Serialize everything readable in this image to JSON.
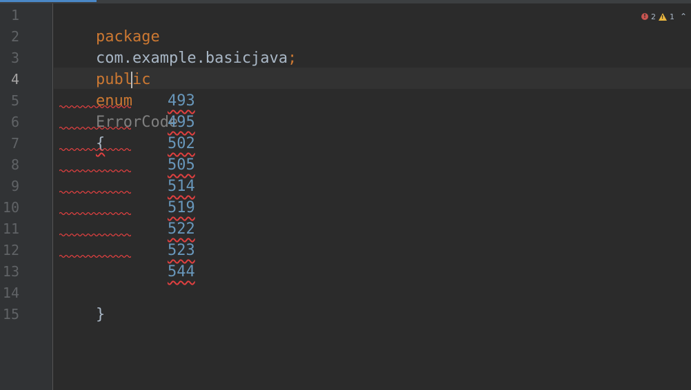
{
  "editor": {
    "line_numbers": [
      "1",
      "2",
      "3",
      "4",
      "5",
      "6",
      "7",
      "8",
      "9",
      "10",
      "11",
      "12",
      "13",
      "14",
      "15"
    ],
    "current_line": "4",
    "package_keyword": "package",
    "package_name": "com.example.basicjava",
    "package_semicolon": ";",
    "public_keyword": "public",
    "enum_keyword": "enum",
    "class_name": "ErrorCode",
    "open_brace": "{",
    "close_brace": "}",
    "enum_values": [
      "493",
      "495",
      "502",
      "505",
      "514",
      "519",
      "522",
      "523",
      "544"
    ]
  },
  "inspection": {
    "error_count": "2",
    "warning_count": "1",
    "error_icon": "error-icon",
    "warning_icon": "warning-icon",
    "expand_icon": "chevron-up-icon"
  },
  "colors": {
    "background": "#2b2b2b",
    "keyword": "#cc7832",
    "number": "#6897bb",
    "error": "#e04040"
  }
}
